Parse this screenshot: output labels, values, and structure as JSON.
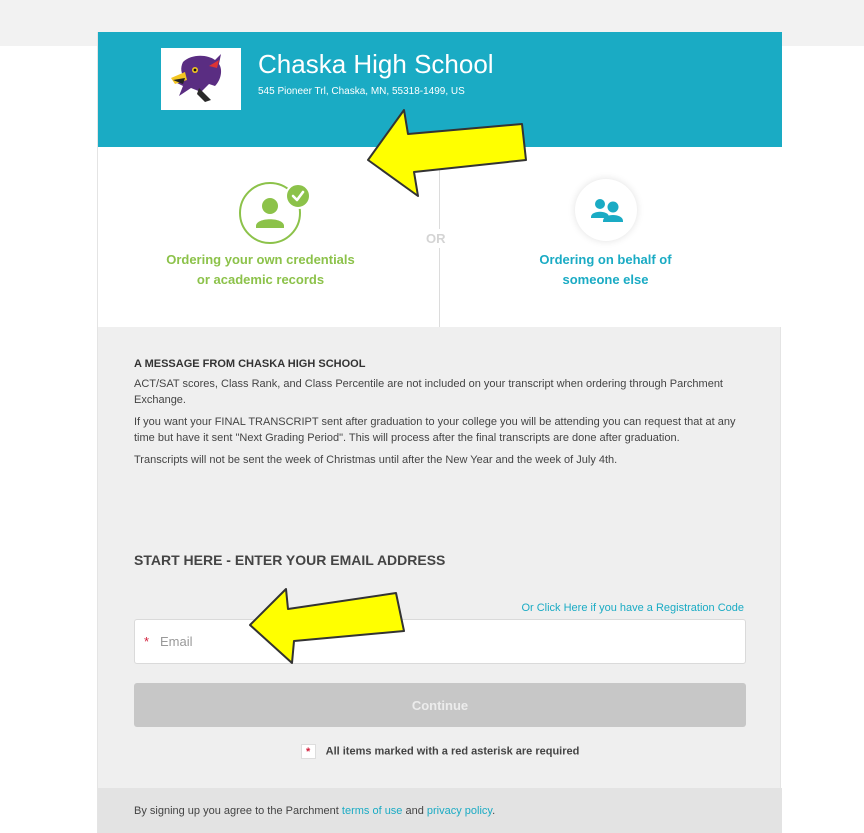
{
  "school": {
    "name": "Chaska High School",
    "address": "545 Pioneer Trl, Chaska, MN, 55318-1499, US"
  },
  "choices": {
    "self": {
      "line1": "Ordering your own credentials",
      "line2": "or academic records",
      "icon": "user-check-icon"
    },
    "separator": "OR",
    "other": {
      "line1": "Ordering on behalf of",
      "line2": "someone else",
      "icon": "users-icon"
    }
  },
  "message": {
    "title": "A MESSAGE FROM CHASKA HIGH SCHOOL",
    "paragraphs": [
      "ACT/SAT scores, Class Rank, and Class Percentile are not included on your transcript when ordering through Parchment Exchange.",
      "If you want your FINAL TRANSCRIPT sent after graduation to your college you will be attending you can request that at any time but have it sent \"Next Grading Period\". This will process after the final transcripts are done after graduation.",
      "Transcripts will not be sent the week of Christmas until after the New Year and the week of July 4th."
    ]
  },
  "form": {
    "heading": "START HERE - ENTER YOUR EMAIL ADDRESS",
    "registration_link": "Or Click Here if you have a Registration Code",
    "email_placeholder": "Email",
    "email_value": "",
    "required_marker": "*",
    "continue_label": "Continue",
    "required_note": "All items marked with a red asterisk are required"
  },
  "footer": {
    "prefix": "By signing up you agree to the Parchment ",
    "terms_link": "terms of use",
    "conjunction": " and ",
    "privacy_link": "privacy policy",
    "suffix": "."
  },
  "colors": {
    "brand_teal": "#1aabc4",
    "accent_green": "#8cc24a",
    "required_red": "#d21f3c",
    "annotation_arrow": "#ffff00"
  }
}
